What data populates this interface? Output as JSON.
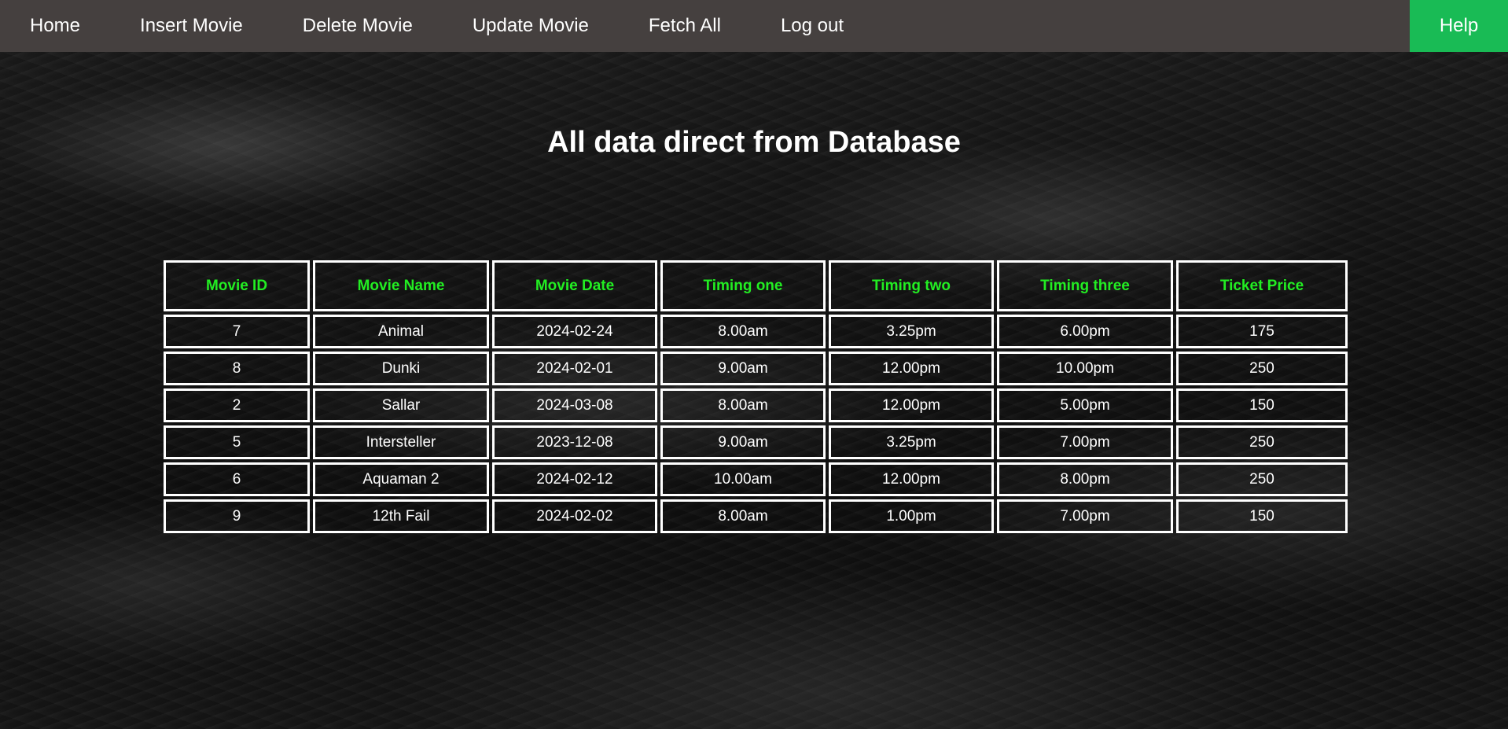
{
  "nav": {
    "items": [
      {
        "label": "Home"
      },
      {
        "label": "Insert Movie"
      },
      {
        "label": "Delete Movie"
      },
      {
        "label": "Update Movie"
      },
      {
        "label": "Fetch All"
      },
      {
        "label": "Log out"
      }
    ],
    "help_label": "Help",
    "help_color": "#19bb55",
    "bar_color": "#45403f"
  },
  "page": {
    "title": "All data direct from Database"
  },
  "table": {
    "header_color": "#22ee22",
    "columns": [
      "Movie ID",
      "Movie Name",
      "Movie Date",
      "Timing one",
      "Timing two",
      "Timing three",
      "Ticket Price"
    ],
    "rows": [
      [
        "7",
        "Animal",
        "2024-02-24",
        "8.00am",
        "3.25pm",
        "6.00pm",
        "175"
      ],
      [
        "8",
        "Dunki",
        "2024-02-01",
        "9.00am",
        "12.00pm",
        "10.00pm",
        "250"
      ],
      [
        "2",
        "Sallar",
        "2024-03-08",
        "8.00am",
        "12.00pm",
        "5.00pm",
        "150"
      ],
      [
        "5",
        "Intersteller",
        "2023-12-08",
        "9.00am",
        "3.25pm",
        "7.00pm",
        "250"
      ],
      [
        "6",
        "Aquaman 2",
        "2024-02-12",
        "10.00am",
        "12.00pm",
        "8.00pm",
        "250"
      ],
      [
        "9",
        "12th Fail",
        "2024-02-02",
        "8.00am",
        "1.00pm",
        "7.00pm",
        "150"
      ]
    ]
  }
}
